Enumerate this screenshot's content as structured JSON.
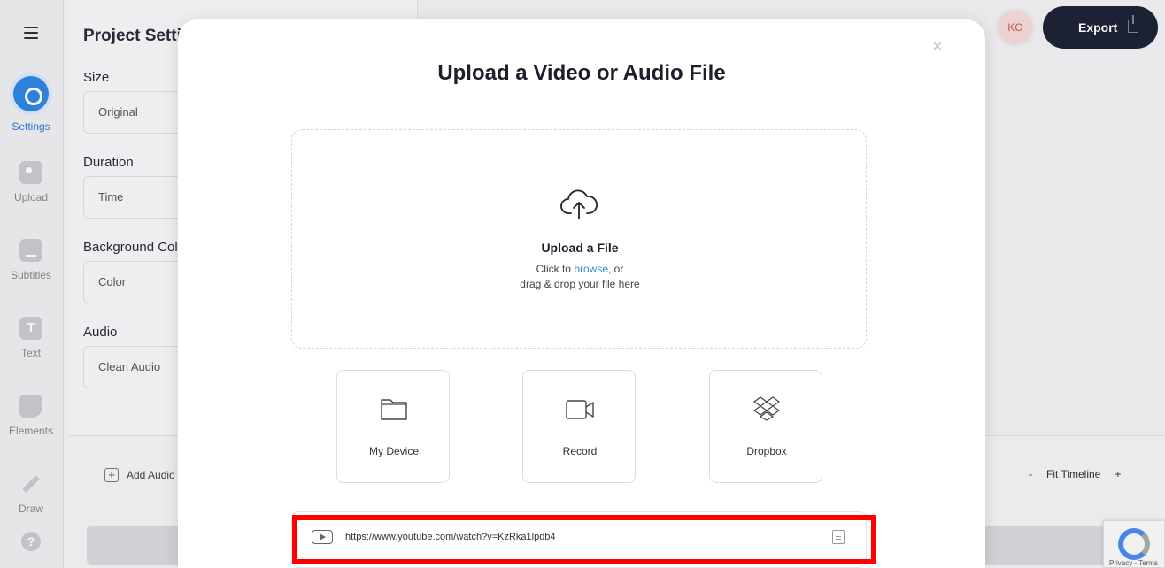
{
  "rail": {
    "items": [
      {
        "label": "Settings",
        "icon": "settings-icon",
        "active": true
      },
      {
        "label": "Upload",
        "icon": "image-icon"
      },
      {
        "label": "Subtitles",
        "icon": "subtitles-icon"
      },
      {
        "label": "Text",
        "icon": "text-icon"
      },
      {
        "label": "Elements",
        "icon": "elements-icon"
      },
      {
        "label": "Draw",
        "icon": "pencil-icon"
      }
    ],
    "help": "?"
  },
  "settings_panel": {
    "title": "Project Setti",
    "fields": [
      {
        "label": "Size",
        "value": "Original"
      },
      {
        "label": "Duration",
        "value": "Time"
      },
      {
        "label": "Background Col",
        "value": "Color"
      },
      {
        "label": "Audio",
        "value": "Clean Audio"
      }
    ]
  },
  "header": {
    "avatar_initials": "KO",
    "export_label": "Export"
  },
  "timeline": {
    "add_audio": "Add Audio",
    "zoom_out": "-",
    "fit_timeline": "Fit Timeline",
    "zoom_in": "+"
  },
  "modal": {
    "close": "×",
    "title": "Upload a Video or Audio File",
    "dropzone": {
      "title": "Upload a File",
      "line1_pre": "Click to ",
      "line1_link": "browse",
      "line1_post": ", or",
      "line2": "drag & drop your file here"
    },
    "sources": [
      {
        "label": "My Device",
        "icon": "folder-icon"
      },
      {
        "label": "Record",
        "icon": "video-camera-icon"
      },
      {
        "label": "Dropbox",
        "icon": "dropbox-icon"
      }
    ],
    "url_input": {
      "value": "https://www.youtube.com/watch?v=KzRka1lpdb4"
    }
  },
  "recaptcha": {
    "text": "Privacy - Terms"
  },
  "colors": {
    "accent": "#2f86e0",
    "export_bg": "#1e2336",
    "highlight": "#ff0000"
  }
}
